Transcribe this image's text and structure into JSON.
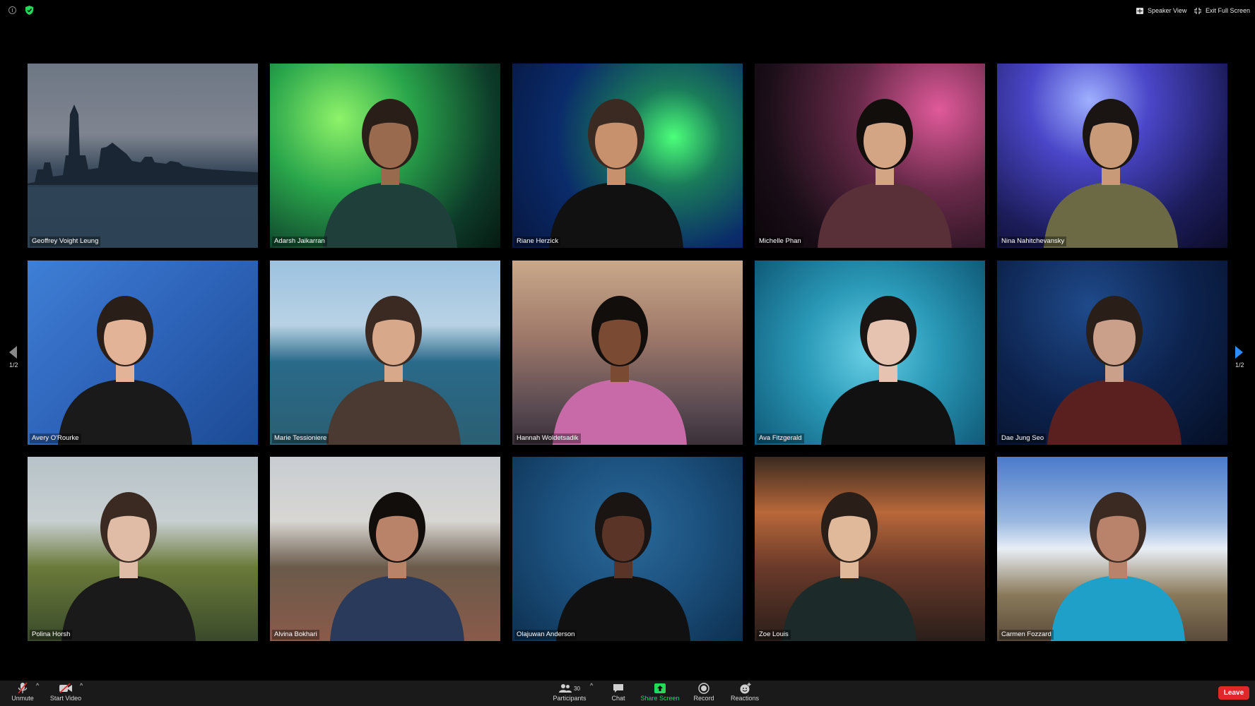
{
  "topbar": {
    "speaker_view_label": "Speaker View",
    "exit_fullscreen_label": "Exit Full Screen",
    "info_icon": "info-icon",
    "security_icon": "shield-check-icon",
    "security_color": "#23d959"
  },
  "participants": [
    {
      "name": "Geoffrey Voight Leung",
      "bg": "linear-gradient(180deg,#6e7785 0%,#7f8590 38%,#3a4a5c 58%,#2b3c4f 100%)",
      "person": "none",
      "skin": "#c99b7a",
      "shirt": "#1c2a3a"
    },
    {
      "name": "Adarsh Jaikarran",
      "bg": "radial-gradient(circle at 30% 30%,#8ff36a 0%,#2aa64b 35%,#0d3b2a 75%,#061a12 100%)",
      "person": "yes",
      "skin": "#9a6a4f",
      "shirt": "#1f3f3a"
    },
    {
      "name": "Riane Herzick",
      "bg": "radial-gradient(circle at 70% 40%,#4cff7a 0%,#1a7b5a 25%,#0a2b6a 60%,#071740 100%)",
      "person": "yes",
      "skin": "#c8916e",
      "shirt": "#111111"
    },
    {
      "name": "Michelle Phan",
      "bg": "radial-gradient(circle at 80% 25%,#e05a9a 0%,#6a2a4a 35%,#1a0e18 75%,#0a0508 100%)",
      "person": "yes",
      "skin": "#d4a585",
      "shirt": "#5a3038"
    },
    {
      "name": "Nina Nahitchevansky",
      "bg": "radial-gradient(circle at 40% 20%,#9fb0ff 0%,#4a46c8 30%,#1c1c5a 70%,#0c0c2a 100%)",
      "person": "yes",
      "skin": "#c99a78",
      "shirt": "#6b6a45"
    },
    {
      "name": "Avery O'Rourke",
      "bg": "linear-gradient(135deg,#3f7fd6 0%,#2d63b8 50%,#1c4a94 100%)",
      "person": "yes",
      "skin": "#e2b397",
      "shirt": "#1a1a1a"
    },
    {
      "name": "Marie Tessioniere",
      "bg": "linear-gradient(180deg,#9cc2e0 0%,#b8d2e4 35%,#2a6a8a 55%,#2b5f72 100%)",
      "person": "yes",
      "skin": "#d8a88a",
      "shirt": "#4a3a32"
    },
    {
      "name": "Hannah Woldetsadik",
      "bg": "linear-gradient(180deg,#c8a88a 0%,#a07a6a 40%,#5a4a52 80%,#3a3038 100%)",
      "person": "yes",
      "skin": "#7a4a32",
      "shirt": "#c86aa8"
    },
    {
      "name": "Ava Fitzgerald",
      "bg": "radial-gradient(circle at 50% 50%,#6ad0e6 0%,#2a9ab8 45%,#0f5a78 100%)",
      "person": "yes",
      "skin": "#e6c2b0",
      "shirt": "#111111"
    },
    {
      "name": "Dae Jung Seo",
      "bg": "radial-gradient(circle at 40% 25%,#1f4a8a 0%,#0d2450 50%,#050e24 100%)",
      "person": "yes",
      "skin": "#caa08a",
      "shirt": "#5a2020"
    },
    {
      "name": "Polina Horsh",
      "bg": "linear-gradient(180deg,#b7c3c9 0%,#c8cfd1 35%,#6a7a3a 60%,#3a4a2a 100%)",
      "person": "yes",
      "skin": "#e0bca6",
      "shirt": "#1a1a1a"
    },
    {
      "name": "Alvina Bokhari",
      "bg": "linear-gradient(180deg,#c8cdd2 0%,#d8d6d2 35%,#6a5a4a 60%,#8a5a4a 100%)",
      "person": "yes",
      "skin": "#b9836a",
      "shirt": "#2a3a5a"
    },
    {
      "name": "Olajuwan Anderson",
      "bg": "radial-gradient(circle at 50% 40%,#2a6a9a 0%,#1b4f7c 50%,#0d3050 100%)",
      "person": "yes",
      "skin": "#5a3426",
      "shirt": "#111111"
    },
    {
      "name": "Zoe Louis",
      "bg": "linear-gradient(180deg,#3a2a20 0%,#b8683a 30%,#6a3a2a 60%,#2a1e1a 100%)",
      "person": "yes",
      "skin": "#e0b89a",
      "shirt": "#1c2a2a"
    },
    {
      "name": "Carmen Fozzard",
      "bg": "linear-gradient(180deg,#4a7acb 0%,#9ab8e0 35%,#e8eef5 50%,#8a7a5a 75%,#5a4a3a 100%)",
      "person": "yes",
      "skin": "#b8836a",
      "shirt": "#1ea0c8"
    }
  ],
  "pagination": {
    "prev_label": "1/2",
    "next_label": "1/2",
    "next_color": "#2d8cff"
  },
  "toolbar": {
    "unmute_label": "Unmute",
    "start_video_label": "Start Video",
    "participants_label": "Participants",
    "participants_count": "30",
    "chat_label": "Chat",
    "share_screen_label": "Share Screen",
    "record_label": "Record",
    "reactions_label": "Reactions",
    "leave_label": "Leave",
    "share_color": "#23d959",
    "mute_slash_color": "#e02828",
    "leave_color": "#e02828"
  }
}
